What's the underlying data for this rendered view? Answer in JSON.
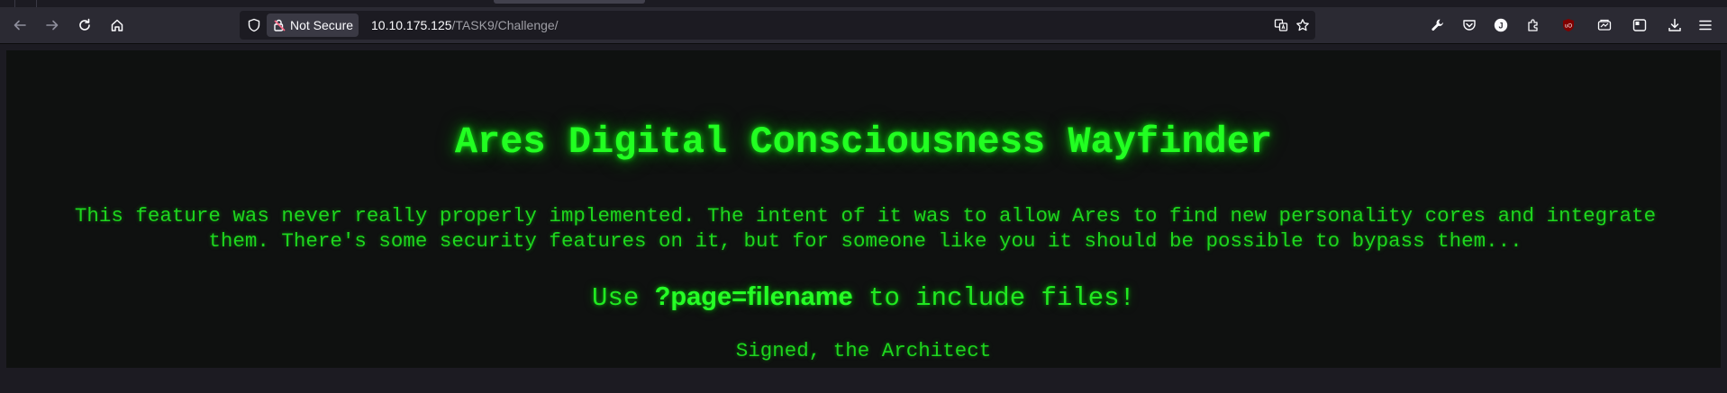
{
  "browser": {
    "security_label": "Not Secure",
    "url": {
      "host": "10.10.175.125",
      "path": "/TASK9/Challenge/"
    },
    "icons": {
      "back": "back-arrow-icon",
      "forward": "forward-arrow-icon",
      "reload": "reload-icon",
      "home": "home-icon",
      "tracking": "shield-icon",
      "insecure": "insecure-lock-icon",
      "translate": "translate-icon",
      "bookmark": "star-icon",
      "toolbar": [
        "wrench-icon",
        "pocket-icon",
        "account-icon",
        "extensions-icon",
        "ublock-icon",
        "tab-icon",
        "sidebar-icon",
        "download-icon",
        "menu-icon"
      ]
    },
    "colors": {
      "toolbar": "#2b2a33",
      "urlbar": "#1c1b22",
      "icon": "#fbfbfe",
      "ublock": "#800000"
    }
  },
  "page": {
    "title": "Ares Digital Consciousness Wayfinder",
    "intro_line1": "This feature was never really properly implemented. The intent of it was to allow Ares to find new personality cores and integrate",
    "intro_line2": "them. There's some security features on it, but for someone like you it should be possible to bypass them...",
    "instruction_prefix": "Use ",
    "instruction_code": "?page=filename",
    "instruction_suffix": " to include files!",
    "signature": "Signed, the Architect",
    "colors": {
      "background": "#0f1110",
      "text_green": "#1ed61e",
      "glow_green": "#22ff22"
    }
  }
}
